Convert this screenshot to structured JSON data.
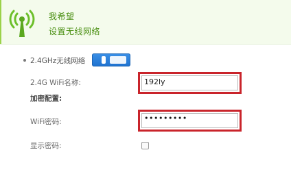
{
  "header": {
    "title": "我希望",
    "subtitle": "设置无线网络",
    "icon": "wifi-icon",
    "accent_color": "#4a8f12"
  },
  "wireless": {
    "band_label": "2.4GHz无线网络",
    "toggle_on": true,
    "toggle_color": "#1f72cf"
  },
  "ssid": {
    "label": "2.4G WiFi名称:",
    "value": "192ly"
  },
  "encryption": {
    "section_label": "加密配置:"
  },
  "password": {
    "label": "WiFi密码:",
    "masked_value": "•••••••••"
  },
  "show_password": {
    "label": "显示密码:",
    "checked": false
  },
  "highlight_color": "#c9242b"
}
